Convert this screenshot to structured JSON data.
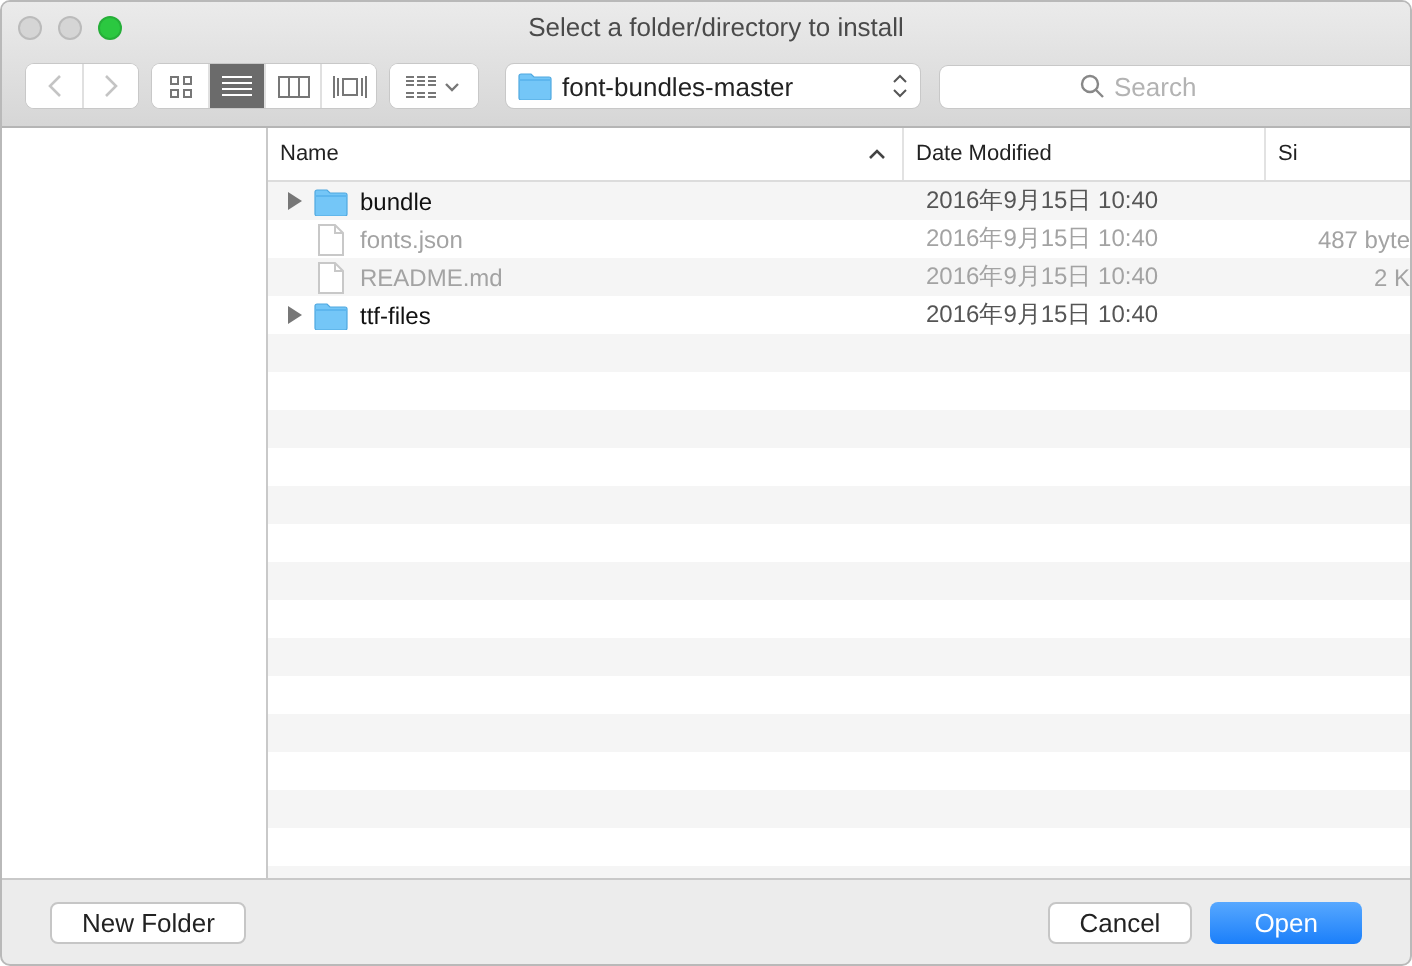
{
  "window": {
    "title": "Select a folder/directory to install"
  },
  "toolbar": {
    "view_modes": [
      {
        "selected": false
      },
      {
        "selected": true
      },
      {
        "selected": false
      },
      {
        "selected": false
      }
    ],
    "location": "font-bundles-master",
    "search": {
      "placeholder": "Search"
    }
  },
  "table": {
    "columns": [
      "Name",
      "Date Modified",
      "Si"
    ],
    "rows": [
      {
        "kind": "folder",
        "enabled": true,
        "name": "bundle",
        "date": "2016年9月15日 10:40",
        "size": ""
      },
      {
        "kind": "file",
        "enabled": false,
        "name": "fonts.json",
        "date": "2016年9月15日 10:40",
        "size": "487 byte"
      },
      {
        "kind": "file",
        "enabled": false,
        "name": "README.md",
        "date": "2016年9月15日 10:40",
        "size": "2 K"
      },
      {
        "kind": "folder",
        "enabled": true,
        "name": "ttf-files",
        "date": "2016年9月15日 10:40",
        "size": ""
      }
    ]
  },
  "footer": {
    "new_folder": "New Folder",
    "cancel": "Cancel",
    "open": "Open"
  }
}
